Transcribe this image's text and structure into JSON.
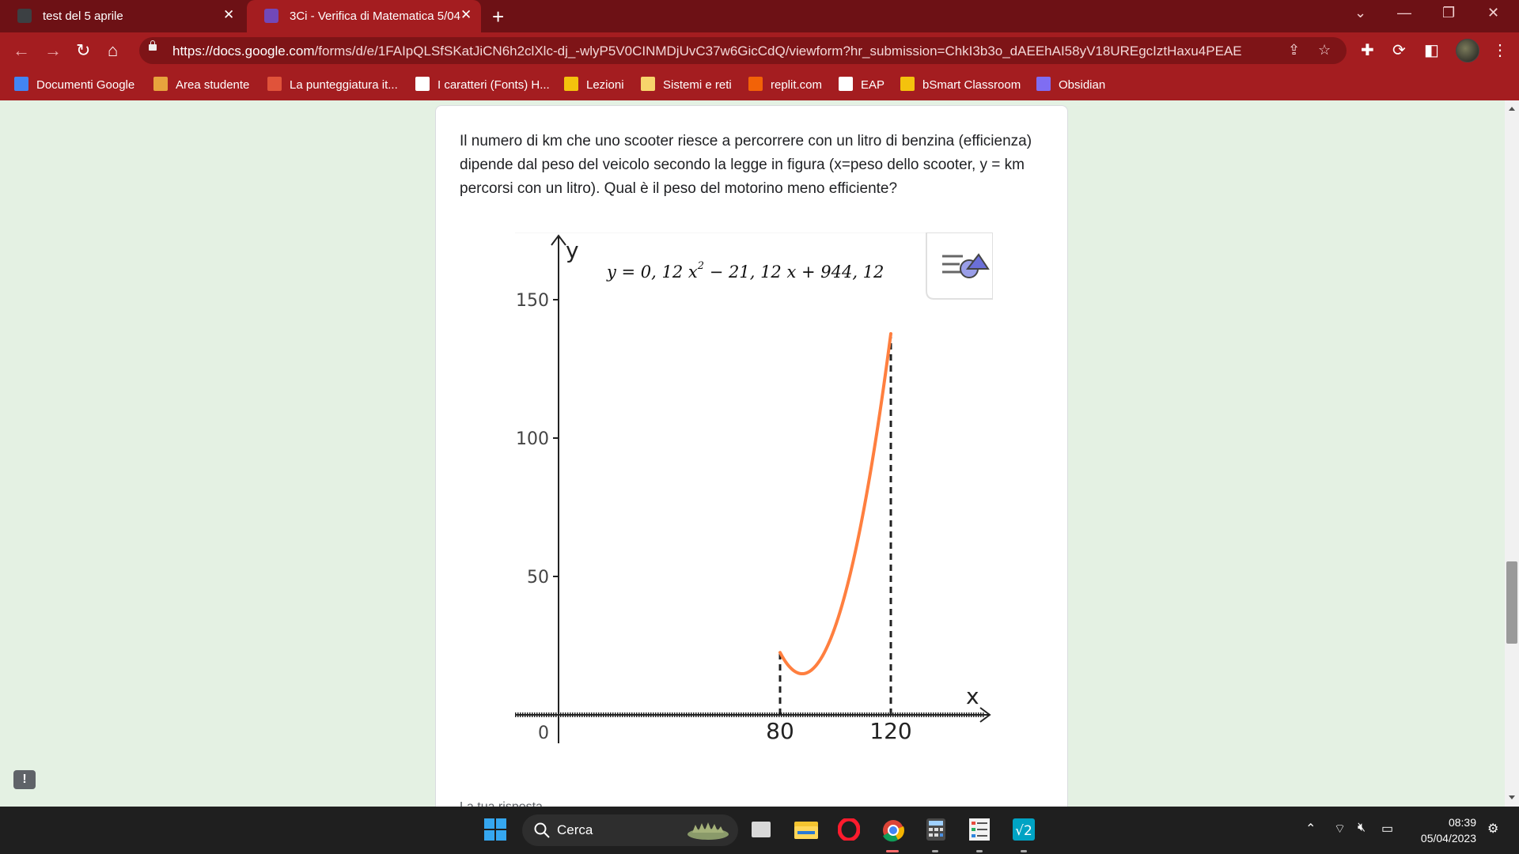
{
  "tabs": [
    {
      "title": "test del 5 aprile",
      "close": "✕"
    },
    {
      "title": "3Ci - Verifica di Matematica 5/04",
      "close": "✕"
    }
  ],
  "new_tab": "+",
  "window_controls": {
    "dropdown": "⌄",
    "minimize": "—",
    "restore": "❐",
    "close": "✕"
  },
  "address_bar": {
    "url_domain": "https://docs.google.com",
    "url_path": "/forms/d/e/1FAIpQLSfSKatJiCN6h2clXlc-dj_-wlyP5V0CINMDjUvC37w6GicCdQ/viewform?hr_submission=ChkI3b3o_dAEEhAI58yV18UREgcIztHaxu4PEAE"
  },
  "bookmarks": [
    {
      "label": "Documenti Google",
      "color": "#4285f4"
    },
    {
      "label": "Area studente",
      "color": "#e8a33d"
    },
    {
      "label": "La punteggiatura it...",
      "color": "#e0533a"
    },
    {
      "label": "I caratteri (Fonts) H...",
      "color": "#ffffff"
    },
    {
      "label": "Lezioni",
      "color": "#f4c20d"
    },
    {
      "label": "Sistemi e reti",
      "color": "#f7d46b"
    },
    {
      "label": "replit.com",
      "color": "#f26207"
    },
    {
      "label": "EAP",
      "color": "#ffffff"
    },
    {
      "label": "bSmart Classroom",
      "color": "#f4c20d"
    },
    {
      "label": "Obsidian",
      "color": "#7f6df2"
    }
  ],
  "question": {
    "text": "Il numero di km che uno scooter riesce a percorrere con un litro di benzina (efficienza) dipende dal peso del veicolo secondo la legge in figura (x=peso dello scooter, y = km percorsi con un litro). Qual è il peso del motorino meno efficiente?",
    "answer_label": "La tua risposta"
  },
  "graph": {
    "formula_prefix": "y = 0, 12 x",
    "formula_exp": "2",
    "formula_suffix": " − 21, 12 x + 944, 12",
    "x_axis_label": "x",
    "y_axis_label": "y",
    "origin_label": "0",
    "y_ticks": [
      {
        "value": 50,
        "label": "50"
      },
      {
        "value": 100,
        "label": "100"
      },
      {
        "value": 150,
        "label": "150"
      }
    ],
    "x_marks": [
      {
        "value": 80,
        "label": "80"
      },
      {
        "value": 120,
        "label": "120"
      }
    ],
    "function": {
      "a": 0.12,
      "b": -21.12,
      "c": 944.12,
      "x_from": 80,
      "x_to": 120
    },
    "curve_color": "#ff7f3f",
    "x_range": [
      0,
      160
    ],
    "y_range": [
      0,
      170
    ]
  },
  "feedback_icon": "!",
  "taskbar": {
    "search_label": "Cerca",
    "time": "08:39",
    "date": "05/04/2023"
  }
}
